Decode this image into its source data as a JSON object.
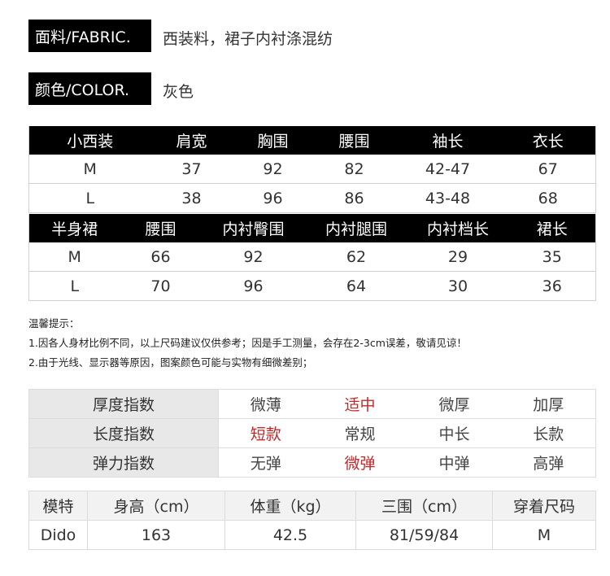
{
  "fabric": {
    "label": "面料/FABRIC.",
    "value": "西装料，裙子内衬涤混纺"
  },
  "color": {
    "label": "颜色/COLOR.",
    "value": "灰色"
  },
  "jacket_table": {
    "headers": [
      "小西装",
      "肩宽",
      "胸围",
      "腰围",
      "袖长",
      "衣长"
    ],
    "rows": [
      [
        "M",
        "37",
        "92",
        "82",
        "42-47",
        "67"
      ],
      [
        "L",
        "38",
        "96",
        "86",
        "43-48",
        "68"
      ]
    ]
  },
  "skirt_table": {
    "headers": [
      "半身裙",
      "腰围",
      "内衬臀围",
      "内衬腿围",
      "内衬档长",
      "裙长"
    ],
    "rows": [
      [
        "M",
        "66",
        "92",
        "62",
        "29",
        "35"
      ],
      [
        "L",
        "70",
        "96",
        "64",
        "30",
        "36"
      ]
    ]
  },
  "tips": {
    "title": "温馨提示：",
    "line1": "1.因各人身材比例不同，以上尺码建议仅供参考；因是手工测量，会存在2-3cm误差，敬请见谅！",
    "line2": "2.由于光线、显示器等原因，图案颜色可能与实物有细微差别；"
  },
  "attributes": {
    "highlight_color": "#c0282a",
    "rows": [
      {
        "name": "厚度指数",
        "options": [
          "微薄",
          "适中",
          "微厚",
          "加厚"
        ],
        "selected": 1
      },
      {
        "name": "长度指数",
        "options": [
          "短款",
          "常规",
          "中长",
          "长款"
        ],
        "selected": 0
      },
      {
        "name": "弹力指数",
        "options": [
          "无弹",
          "微弹",
          "中弹",
          "高弹"
        ],
        "selected": 1
      }
    ]
  },
  "model": {
    "headers": [
      "模特",
      "身高（cm）",
      "体重（kg）",
      "三围（cm）",
      "穿着尺码"
    ],
    "values": [
      "Dido",
      "163",
      "42.5",
      "81/59/84",
      "M"
    ]
  }
}
